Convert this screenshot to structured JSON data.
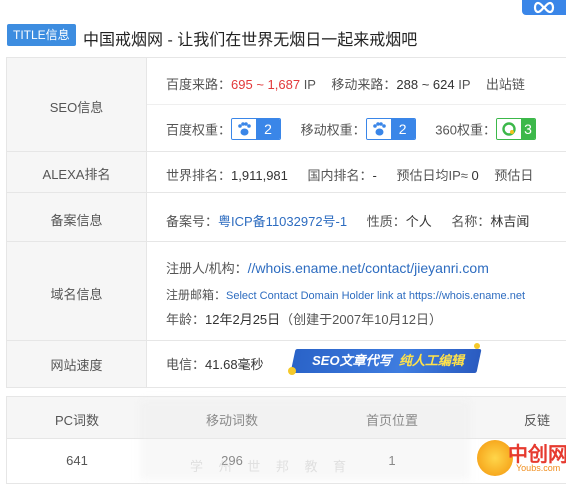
{
  "header": {
    "badge": "TITLE信息",
    "title": "中国戒烟网 - 让我们在世界无烟日一起来戒烟吧"
  },
  "seo": {
    "label": "SEO信息",
    "baidu_source_label": "百度来路：",
    "baidu_source_value": "695 ~ 1,687",
    "baidu_source_unit": "IP",
    "mobile_source_label": "移动来路：",
    "mobile_source_value": "288 ~ 624",
    "mobile_source_unit": "IP",
    "outbound_label": "出站链",
    "baidu_weight_label": "百度权重：",
    "baidu_weight_value": "2",
    "mobile_weight_label": "移动权重：",
    "mobile_weight_value": "2",
    "w360_label": "360权重：",
    "w360_value": "3"
  },
  "alexa": {
    "label": "ALEXA排名",
    "world_rank_label": "世界排名：",
    "world_rank_value": "1,911,981",
    "domestic_rank_label": "国内排名：",
    "domestic_rank_value": "-",
    "daily_ip_label": "预估日均IP≈",
    "daily_ip_value": "0",
    "daily_pv_label": "预估日"
  },
  "icp": {
    "label": "备案信息",
    "number_label": "备案号：",
    "number_value": "粤ICP备11032972号-1",
    "nature_label": "性质：",
    "nature_value": "个人",
    "name_label": "名称：",
    "name_value": "林吉闻"
  },
  "domain": {
    "label": "域名信息",
    "registrant_label": "注册人/机构：",
    "registrant_value": "//whois.ename.net/contact/jieyanri.com",
    "email_label": "注册邮箱：",
    "email_value": "Select Contact Domain Holder link at https://whois.ename.net",
    "age_label": "年龄：",
    "age_value": "12年2月25日",
    "age_note": "（创建于2007年10月12日）"
  },
  "speed": {
    "label": "网站速度",
    "telecom_label": "电信：",
    "telecom_value": "41.68毫秒",
    "banner_part1": "SEO文章代写",
    "banner_part2": "纯人工编辑"
  },
  "bottom_table": {
    "headers": [
      "PC词数",
      "移动词数",
      "首页位置",
      "反链"
    ],
    "values": [
      "641",
      "296",
      "1",
      ""
    ]
  },
  "watermark": {
    "faint_text": "学 州 世 邦 教 育",
    "logo_text": "中创网",
    "logo_url": "Youbs.com"
  },
  "colors": {
    "accent_blue": "#3a86e8",
    "red": "#e2383a",
    "green": "#3cb84a",
    "label_bg": "#f6f6f6"
  },
  "icons": [
    "infinity-icon",
    "baidu-paw-icon",
    "360-icon",
    "dot-icon"
  ]
}
